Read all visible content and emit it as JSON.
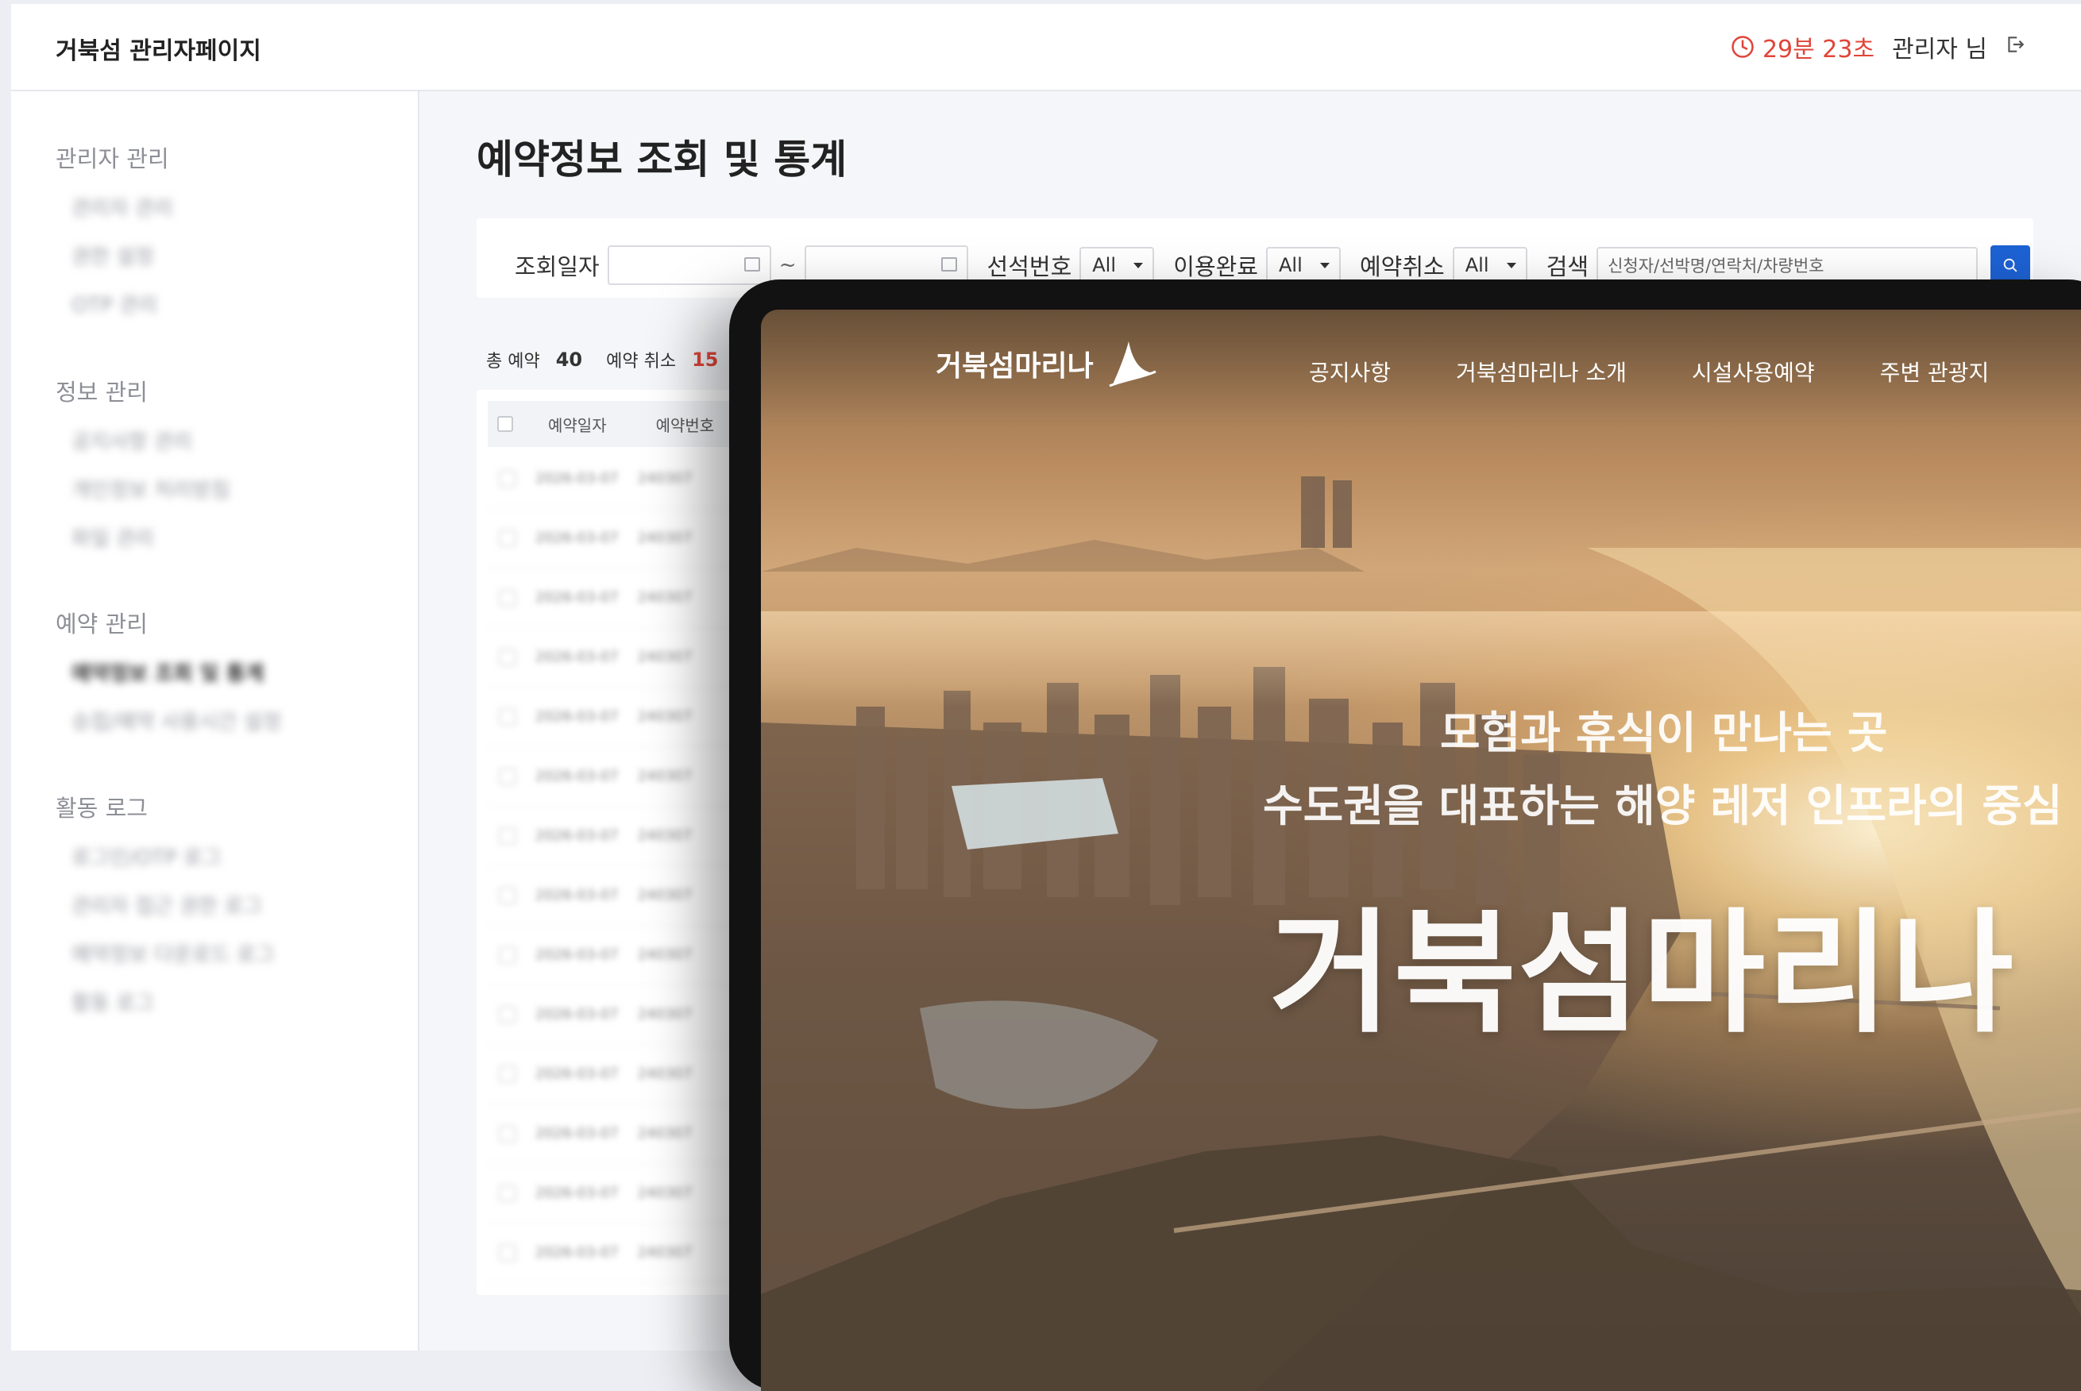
{
  "header": {
    "brand": "거북섬 관리자페이지",
    "timer": "29분 23초",
    "user": "관리자 님"
  },
  "sidebar": {
    "groups": [
      {
        "title": "관리자 관리",
        "items": [
          "관리자 관리",
          "권한 설정",
          "OTP 관리"
        ]
      },
      {
        "title": "정보 관리",
        "items": [
          "공지사항 관리",
          "개인정보 처리방침",
          "파일 관리"
        ]
      },
      {
        "title": "예약 관리",
        "items": [
          "예약정보 조회 및 통계",
          "승접/예약 사용시간 설정"
        ]
      },
      {
        "title": "활동 로그",
        "items": [
          "로그인/OTP 로그",
          "관리자 접근 권한 로그",
          "예약정보 다운로드 로그",
          "활동 로그"
        ]
      }
    ],
    "active_item": "예약정보 조회 및 통계"
  },
  "main": {
    "title": "예약정보 조회 및 통계",
    "filters": {
      "date_label": "조회일자",
      "date_sep": "~",
      "seat_label": "선석번호",
      "seat_value": "All",
      "used_label": "이용완료",
      "used_value": "All",
      "cancel_label": "예약취소",
      "cancel_value": "All",
      "search_label": "검색",
      "search_placeholder": "신청자/선박명/연락처/차량번호"
    },
    "stats": {
      "total_label": "총 예약",
      "total_value": "40",
      "cancel_label": "예약 취소",
      "cancel_value": "15"
    },
    "table": {
      "headers": [
        "예약일자",
        "예약번호"
      ],
      "rows": [
        [
          "2026-03-07",
          "240307"
        ],
        [
          "2026-03-07",
          "240307"
        ],
        [
          "2026-03-07",
          "240307"
        ],
        [
          "2026-03-07",
          "240307"
        ],
        [
          "2026-03-07",
          "240307"
        ],
        [
          "2026-03-07",
          "240307"
        ],
        [
          "2026-03-07",
          "240307"
        ],
        [
          "2026-03-07",
          "240307"
        ],
        [
          "2026-03-07",
          "240307"
        ],
        [
          "2026-03-07",
          "240307"
        ],
        [
          "2026-03-07",
          "240307"
        ],
        [
          "2026-03-07",
          "240307"
        ],
        [
          "2026-03-07",
          "240307"
        ],
        [
          "2026-03-07",
          "240307"
        ]
      ]
    }
  },
  "tablet_site": {
    "logo": "거북섬마리나",
    "menu": [
      "공지사항",
      "거북섬마리나 소개",
      "시설사용예약",
      "주변 관광지"
    ],
    "hero_line1": "모험과 휴식이 만나는 곳",
    "hero_line2": "수도권을 대표하는 해양 레저 인프라의 중심",
    "hero_title": "거북섬마리나"
  },
  "colors": {
    "accent_red": "#e0453a",
    "primary_blue": "#1d62d4"
  }
}
